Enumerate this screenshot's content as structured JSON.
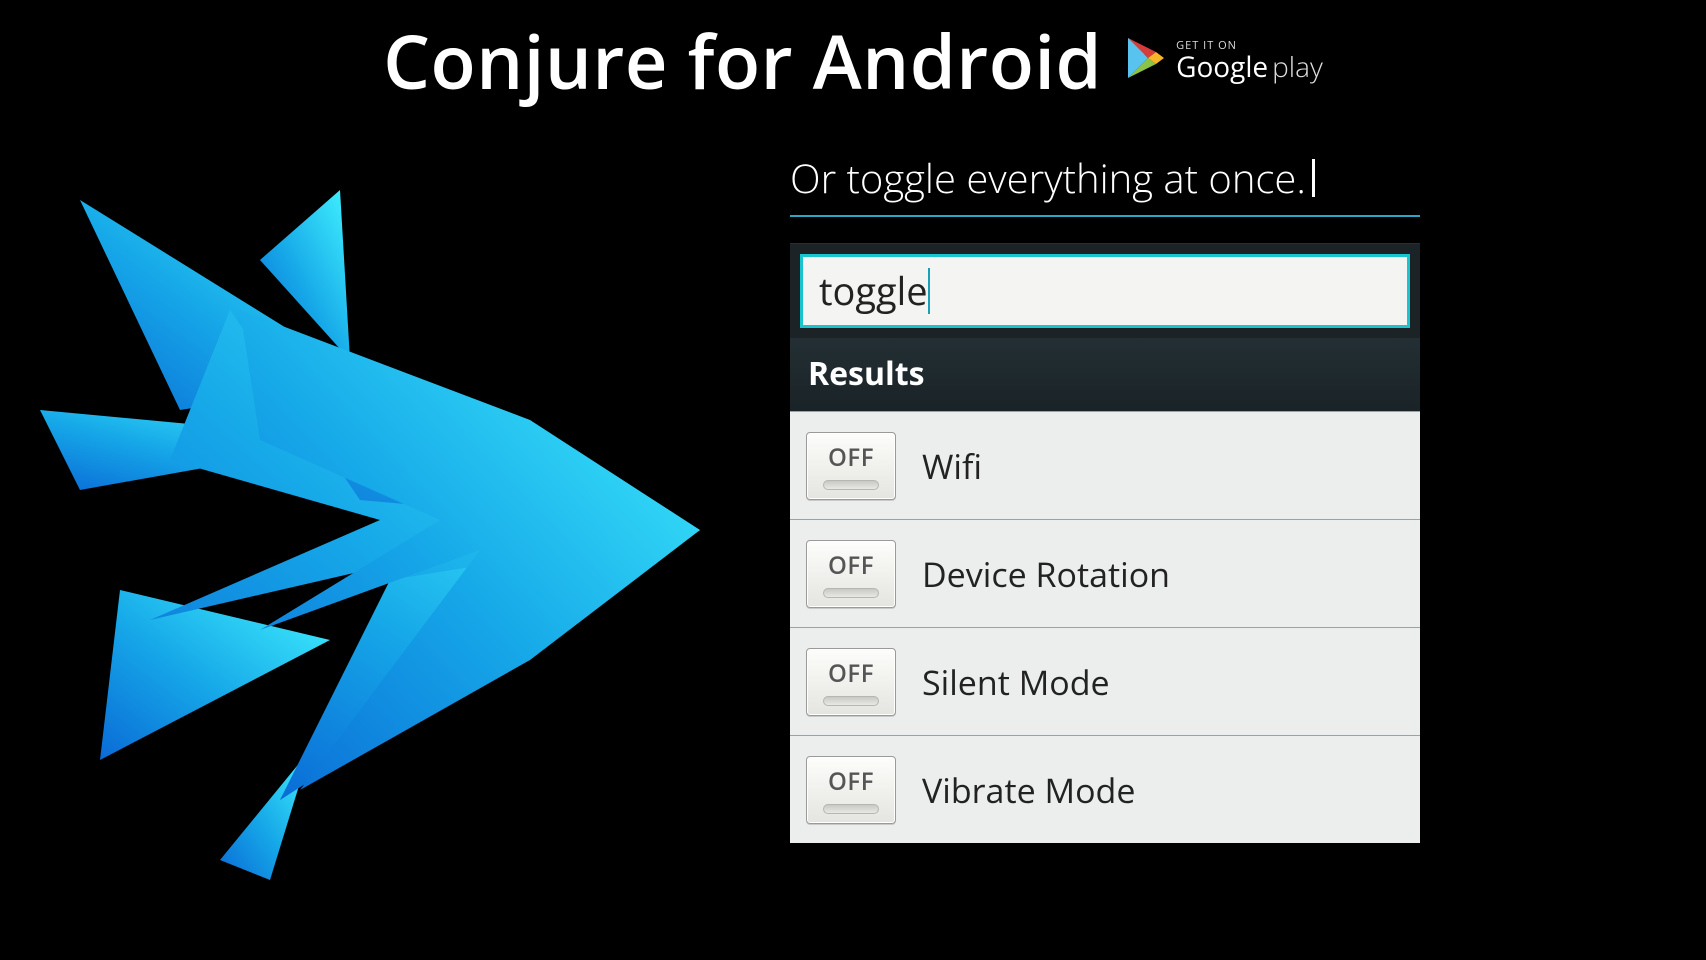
{
  "header": {
    "title": "Conjure for Android",
    "play_badge": {
      "get_it_on": "GET IT ON",
      "google": "Google",
      "play": "play"
    }
  },
  "caption": "Or toggle everything at once.",
  "screen": {
    "search_value": "toggle",
    "results_header": "Results",
    "toggle_state_label": "OFF",
    "items": [
      {
        "label": "Wifi"
      },
      {
        "label": "Device Rotation"
      },
      {
        "label": "Silent Mode"
      },
      {
        "label": "Vibrate Mode"
      }
    ]
  }
}
